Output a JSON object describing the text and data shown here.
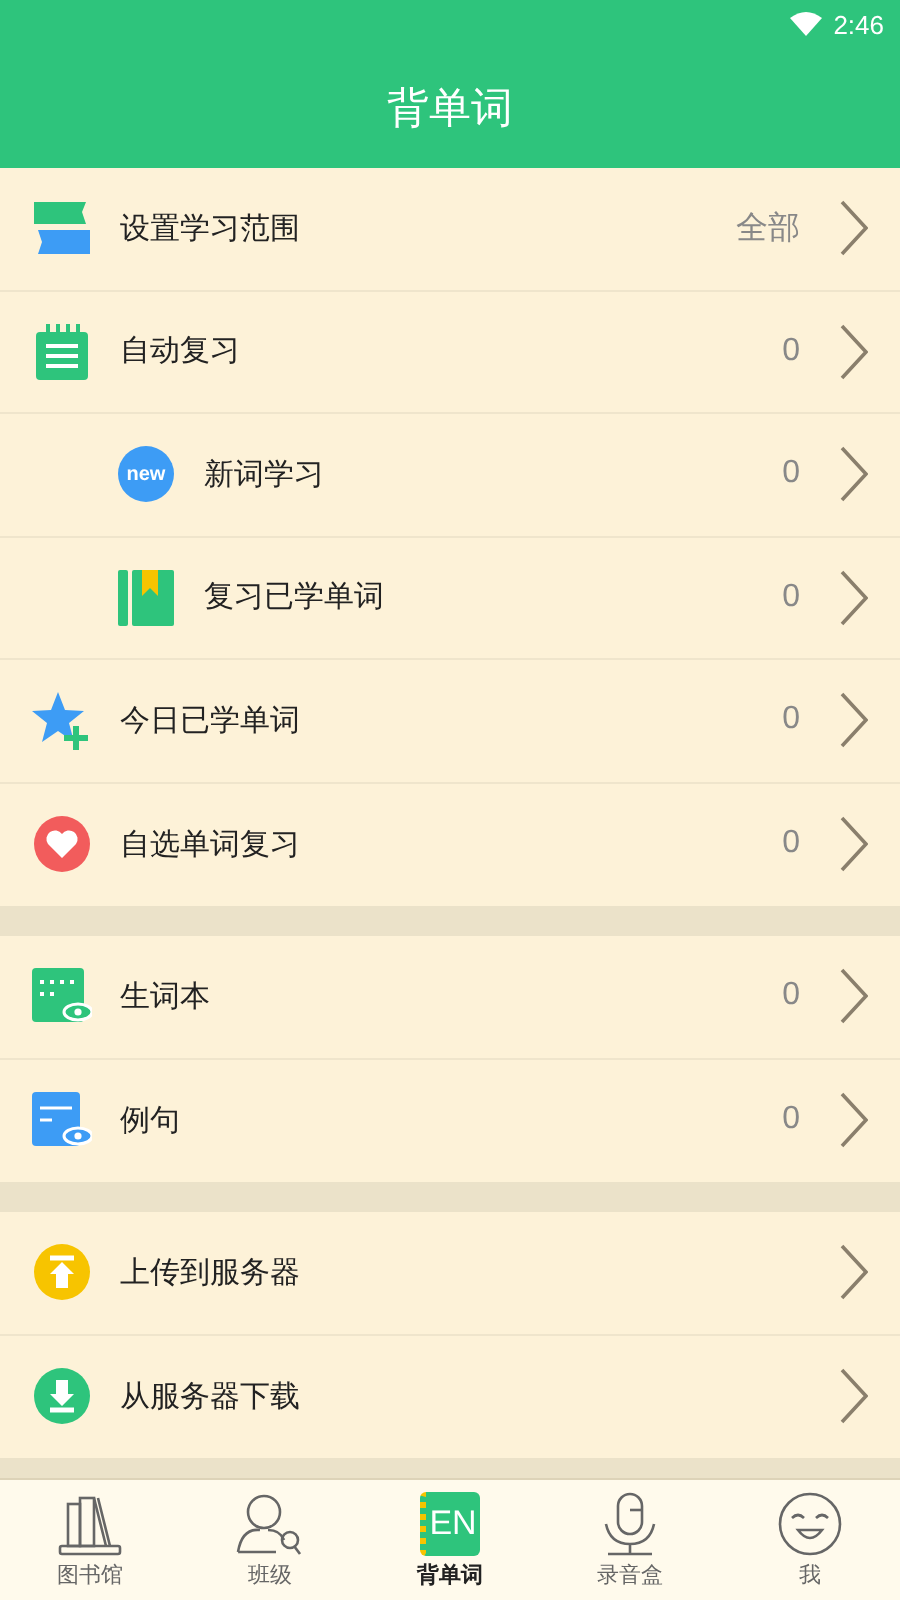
{
  "status_bar": {
    "time": "2:46"
  },
  "header": {
    "title": "背单词"
  },
  "groups": [
    {
      "items": [
        {
          "kind": "range",
          "label": "设置学习范围",
          "value": "全部"
        },
        {
          "kind": "auto",
          "label": "自动复习",
          "value": "0",
          "children": [
            {
              "kind": "new",
              "label": "新词学习",
              "value": "0",
              "badge": "new"
            },
            {
              "kind": "review",
              "label": "复习已学单词",
              "value": "0"
            }
          ]
        },
        {
          "kind": "today",
          "label": "今日已学单词",
          "value": "0"
        },
        {
          "kind": "heart",
          "label": "自选单词复习",
          "value": "0"
        }
      ]
    },
    {
      "items": [
        {
          "kind": "notebook",
          "label": "生词本",
          "value": "0"
        },
        {
          "kind": "examples",
          "label": "例句",
          "value": "0"
        }
      ]
    },
    {
      "items": [
        {
          "kind": "upload",
          "label": "上传到服务器"
        },
        {
          "kind": "download",
          "label": "从服务器下载"
        }
      ]
    }
  ],
  "tabs": [
    {
      "kind": "library",
      "label": "图书馆",
      "selected": false
    },
    {
      "kind": "class",
      "label": "班级",
      "selected": false
    },
    {
      "kind": "words",
      "label": "背单词",
      "selected": true,
      "badge": "EN"
    },
    {
      "kind": "recorder",
      "label": "录音盒",
      "selected": false
    },
    {
      "kind": "me",
      "label": "我",
      "selected": false
    }
  ]
}
